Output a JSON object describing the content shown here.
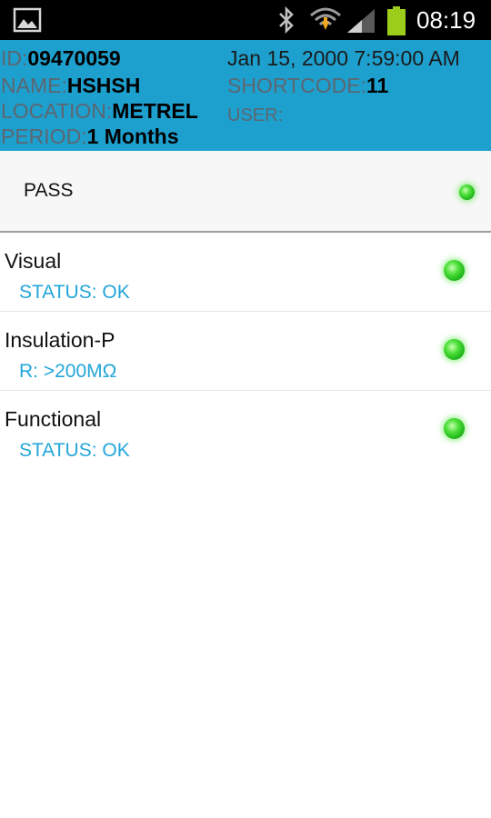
{
  "statusbar": {
    "time": "08:19",
    "icons": [
      "image-icon",
      "bluetooth-icon",
      "wifi-icon",
      "signal-icon",
      "battery-icon"
    ],
    "battery_color": "#9ccd1a"
  },
  "header": {
    "bg_color": "#1ea0cf",
    "id_label": "ID:",
    "id_value": "09470059",
    "name_label": "NAME:",
    "name_value": "HSHSH",
    "location_label": "LOCATION:",
    "location_value": "METREL",
    "period_label": "PERIOD:",
    "period_value": "1 Months",
    "date": "Jan 15, 2000 7:59:00 AM",
    "shortcode_label": "SHORTCODE:",
    "shortcode_value": "11",
    "user_label": "USER:",
    "user_value": ""
  },
  "summary": {
    "label": "PASS",
    "status_color": "#3ddc2f"
  },
  "tests": [
    {
      "title": "Visual",
      "detail": "STATUS: OK"
    },
    {
      "title": "Insulation-P",
      "detail": "R: >200MΩ"
    },
    {
      "title": "Functional",
      "detail": "STATUS: OK"
    }
  ],
  "accent_color": "#22a6d9"
}
